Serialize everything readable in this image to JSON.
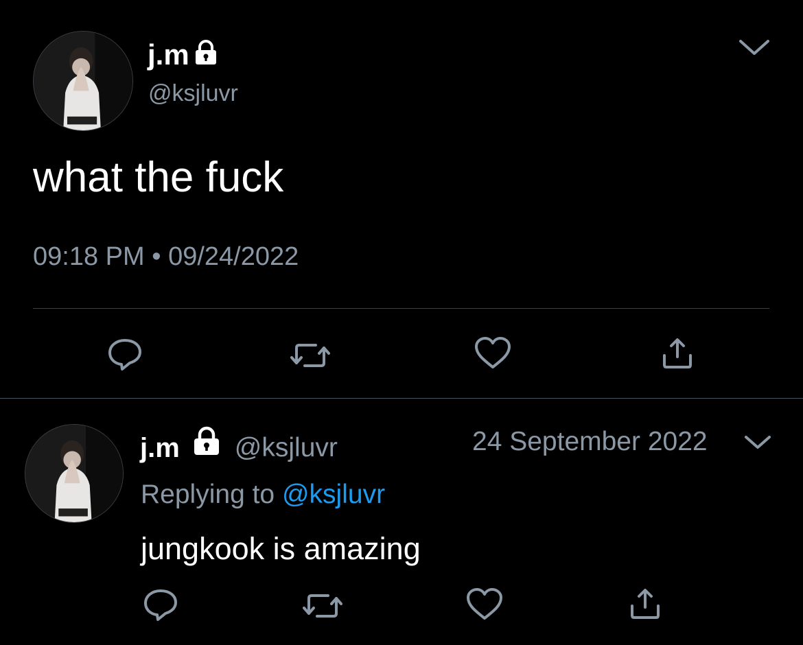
{
  "tweet": {
    "display_name": "j.m",
    "handle": "@ksjluvr",
    "text": "what the fuck",
    "time": "09:18 PM",
    "separator": "•",
    "date": "09/24/2022",
    "avatar_icon": "profile-photo",
    "locked_icon": "lock-icon",
    "actions": [
      "reply-icon",
      "retweet-icon",
      "like-icon",
      "share-icon"
    ]
  },
  "reply": {
    "display_name": "j.m",
    "handle": "@ksjluvr",
    "date": "24 September 2022",
    "replying_prefix": "Replying to",
    "replying_mention": "@ksjluvr",
    "text": "jungkook is amazing",
    "actions": [
      "reply-icon",
      "retweet-icon",
      "like-icon",
      "share-icon"
    ]
  },
  "colors": {
    "background": "#000000",
    "text_primary": "#ffffff",
    "text_secondary": "#8b98a5",
    "link": "#1d9bf0",
    "divider": "#38444d"
  }
}
